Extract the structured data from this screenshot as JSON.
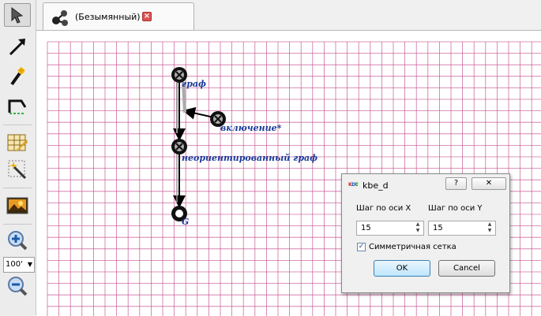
{
  "toolbar": {
    "zoom": "100'",
    "icons": [
      "pointer-icon",
      "arrow-icon",
      "magic-wand-icon",
      "edge-tool-icon",
      "grid-settings-icon",
      "magic-select-icon",
      "image-icon",
      "zoom-in-icon",
      "zoom-out-icon"
    ]
  },
  "tab": {
    "label": "(Безымянный)",
    "close": "×"
  },
  "graph": {
    "nodes": [
      {
        "label": "граф"
      },
      {
        "label": "включение*"
      },
      {
        "label": "неориентированный граф"
      },
      {
        "label": "G"
      }
    ]
  },
  "dialog": {
    "title": "kbe_d",
    "logo": "KDE",
    "help": "?",
    "close": "✕",
    "x_label": "Шаг по оси X",
    "y_label": "Шаг по оси Y",
    "x_value": "15",
    "y_value": "15",
    "symmetric_label": "Симметричная сетка",
    "symmetric_checked": "✓",
    "ok": "OK",
    "cancel": "Cancel"
  },
  "colors": {
    "grid_line": "#c44c8c",
    "label": "#1a3a9a",
    "ok_border": "#3c7fb1"
  }
}
